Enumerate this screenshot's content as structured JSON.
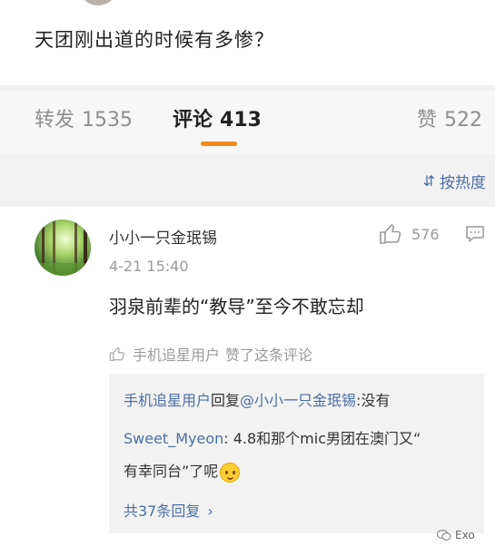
{
  "post": {
    "text": "天团刚出道的时候有多惨？"
  },
  "tabs": [
    {
      "label": "转发",
      "count": "1535"
    },
    {
      "label": "评论",
      "count": "413"
    },
    {
      "label": "赞",
      "count": "522"
    }
  ],
  "sort": {
    "label": "按热度",
    "icon": "sort-icon"
  },
  "comment": {
    "username": "小小一只金珉锡",
    "time": "4-21 15:40",
    "likes": "576",
    "text": "羽泉前辈的“教导”至今不敢忘却",
    "liked_by_user": "手机追星用户",
    "liked_by_suffix": "赞了这条评论",
    "replies": [
      {
        "user": "手机追星用户",
        "verb": "回复",
        "target": "@小小一只金珉锡",
        "content": ":没有"
      },
      {
        "user": "Sweet_Myeon",
        "content_1": ": 4.8和那个mic男团在澳门又“",
        "content_2": "有幸同台”了呢",
        "emoji": "smile-emoji"
      }
    ],
    "more_replies": "共37条回复",
    "more_icon": "chevron-right-icon"
  },
  "watermark": {
    "text": "Exo",
    "icon": "wechat-icon"
  },
  "colors": {
    "accent": "#f18a1b",
    "link": "#4b6fa3"
  }
}
